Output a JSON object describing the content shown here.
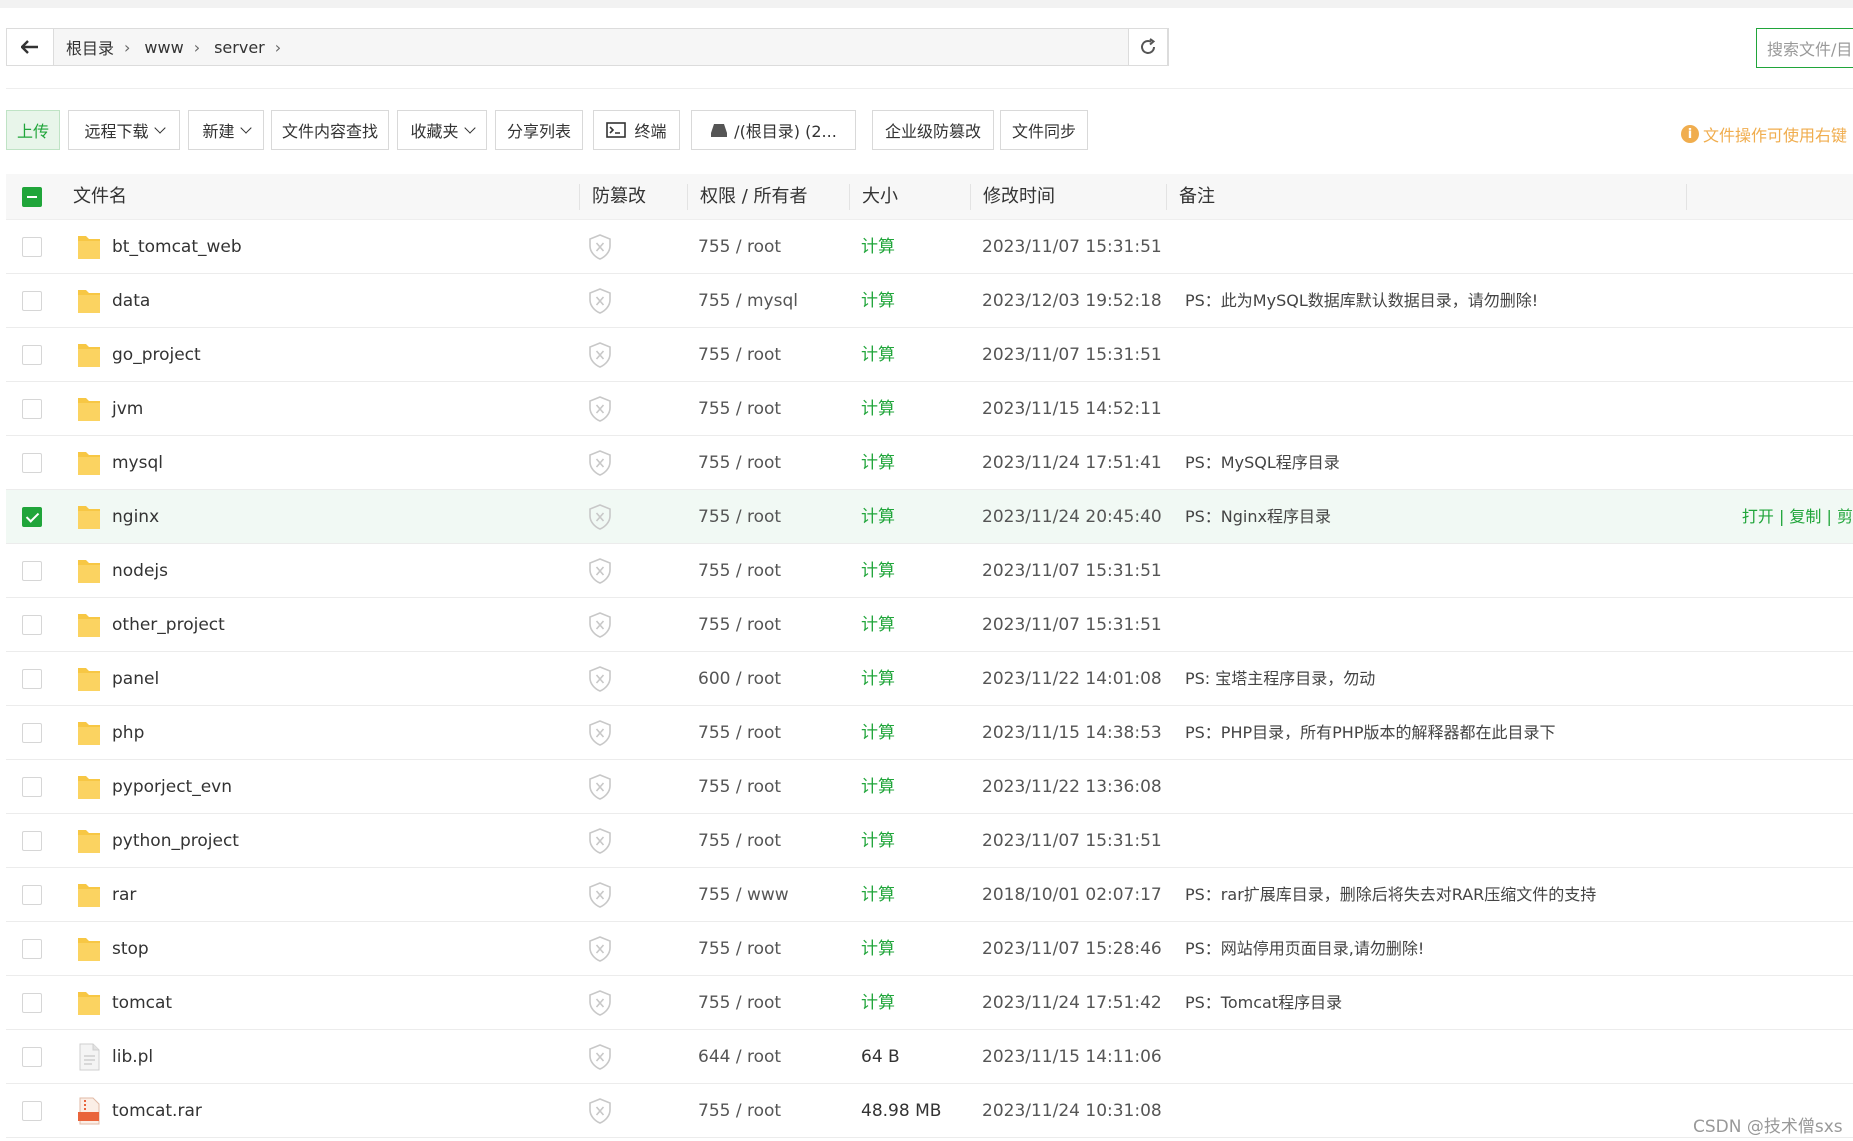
{
  "path": {
    "crumbs": [
      "根目录",
      "www",
      "server"
    ],
    "search_placeholder": "搜索文件/目录"
  },
  "toolbar": {
    "upload": "上传",
    "remote_download": "远程下载",
    "new": "新建",
    "content_search": "文件内容查找",
    "favorites": "收藏夹",
    "share_list": "分享列表",
    "terminal": "终端",
    "disk": "/(根目录) (2...",
    "anti_tamper": "企业级防篡改",
    "file_sync": "文件同步",
    "tip": "文件操作可使用右键"
  },
  "table": {
    "headers": {
      "name": "文件名",
      "tamper": "防篡改",
      "perm": "权限 / 所有者",
      "size": "大小",
      "mtime": "修改时间",
      "note": "备注"
    },
    "rows": [
      {
        "name": "bt_tomcat_web",
        "type": "folder",
        "perm": "755 / root",
        "size": "计算",
        "mtime": "2023/11/07 15:31:51",
        "note": "",
        "selected": false
      },
      {
        "name": "data",
        "type": "folder",
        "perm": "755 / mysql",
        "size": "计算",
        "mtime": "2023/12/03 19:52:18",
        "note": "PS：此为MySQL数据库默认数据目录，请勿删除!",
        "selected": false
      },
      {
        "name": "go_project",
        "type": "folder",
        "perm": "755 / root",
        "size": "计算",
        "mtime": "2023/11/07 15:31:51",
        "note": "",
        "selected": false
      },
      {
        "name": "jvm",
        "type": "folder",
        "perm": "755 / root",
        "size": "计算",
        "mtime": "2023/11/15 14:52:11",
        "note": "",
        "selected": false
      },
      {
        "name": "mysql",
        "type": "folder",
        "perm": "755 / root",
        "size": "计算",
        "mtime": "2023/11/24 17:51:41",
        "note": "PS：MySQL程序目录",
        "selected": false
      },
      {
        "name": "nginx",
        "type": "folder",
        "perm": "755 / root",
        "size": "计算",
        "mtime": "2023/11/24 20:45:40",
        "note": "PS：Nginx程序目录",
        "selected": true,
        "ops": "打开 | 复制 | 剪"
      },
      {
        "name": "nodejs",
        "type": "folder",
        "perm": "755 / root",
        "size": "计算",
        "mtime": "2023/11/07 15:31:51",
        "note": "",
        "selected": false
      },
      {
        "name": "other_project",
        "type": "folder",
        "perm": "755 / root",
        "size": "计算",
        "mtime": "2023/11/07 15:31:51",
        "note": "",
        "selected": false
      },
      {
        "name": "panel",
        "type": "folder",
        "perm": "600 / root",
        "size": "计算",
        "mtime": "2023/11/22 14:01:08",
        "note": "PS: 宝塔主程序目录，勿动",
        "selected": false
      },
      {
        "name": "php",
        "type": "folder",
        "perm": "755 / root",
        "size": "计算",
        "mtime": "2023/11/15 14:38:53",
        "note": "PS：PHP目录，所有PHP版本的解释器都在此目录下",
        "selected": false
      },
      {
        "name": "pyporject_evn",
        "type": "folder",
        "perm": "755 / root",
        "size": "计算",
        "mtime": "2023/11/22 13:36:08",
        "note": "",
        "selected": false
      },
      {
        "name": "python_project",
        "type": "folder",
        "perm": "755 / root",
        "size": "计算",
        "mtime": "2023/11/07 15:31:51",
        "note": "",
        "selected": false
      },
      {
        "name": "rar",
        "type": "folder",
        "perm": "755 / www",
        "size": "计算",
        "mtime": "2018/10/01 02:07:17",
        "note": "PS：rar扩展库目录，删除后将失去对RAR压缩文件的支持",
        "selected": false
      },
      {
        "name": "stop",
        "type": "folder",
        "perm": "755 / root",
        "size": "计算",
        "mtime": "2023/11/07 15:28:46",
        "note": "PS：网站停用页面目录,请勿删除!",
        "selected": false
      },
      {
        "name": "tomcat",
        "type": "folder",
        "perm": "755 / root",
        "size": "计算",
        "mtime": "2023/11/24 17:51:42",
        "note": "PS：Tomcat程序目录",
        "selected": false
      },
      {
        "name": "lib.pl",
        "type": "file",
        "perm": "644 / root",
        "size": "64 B",
        "mtime": "2023/11/15 14:11:06",
        "note": "",
        "selected": false
      },
      {
        "name": "tomcat.rar",
        "type": "rar",
        "perm": "755 / root",
        "size": "48.98 MB",
        "mtime": "2023/11/24 10:31:08",
        "note": "",
        "selected": false
      }
    ]
  },
  "watermark": "CSDN @技术僧sxs",
  "colors": {
    "accent": "#20a53a",
    "warning": "#f0ad4e"
  }
}
